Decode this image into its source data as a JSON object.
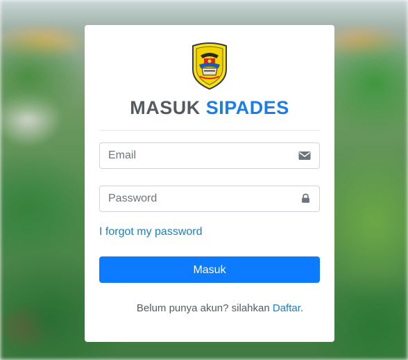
{
  "login": {
    "title_part1": "MASUK",
    "title_part2": "SIPADES",
    "email": {
      "placeholder": "Email",
      "value": "",
      "icon": "envelope-icon"
    },
    "password": {
      "placeholder": "Password",
      "value": "",
      "icon": "lock-icon"
    },
    "forgot_link": "I forgot my password",
    "submit_label": "Masuk",
    "register_text": "Belum punya akun? silahkan",
    "register_link": "Daftar",
    "register_suffix": "."
  },
  "colors": {
    "accent": "#1a7ee6",
    "button": "#0d7bff",
    "link": "#1a7ec8",
    "title_gray": "#555a5f"
  }
}
